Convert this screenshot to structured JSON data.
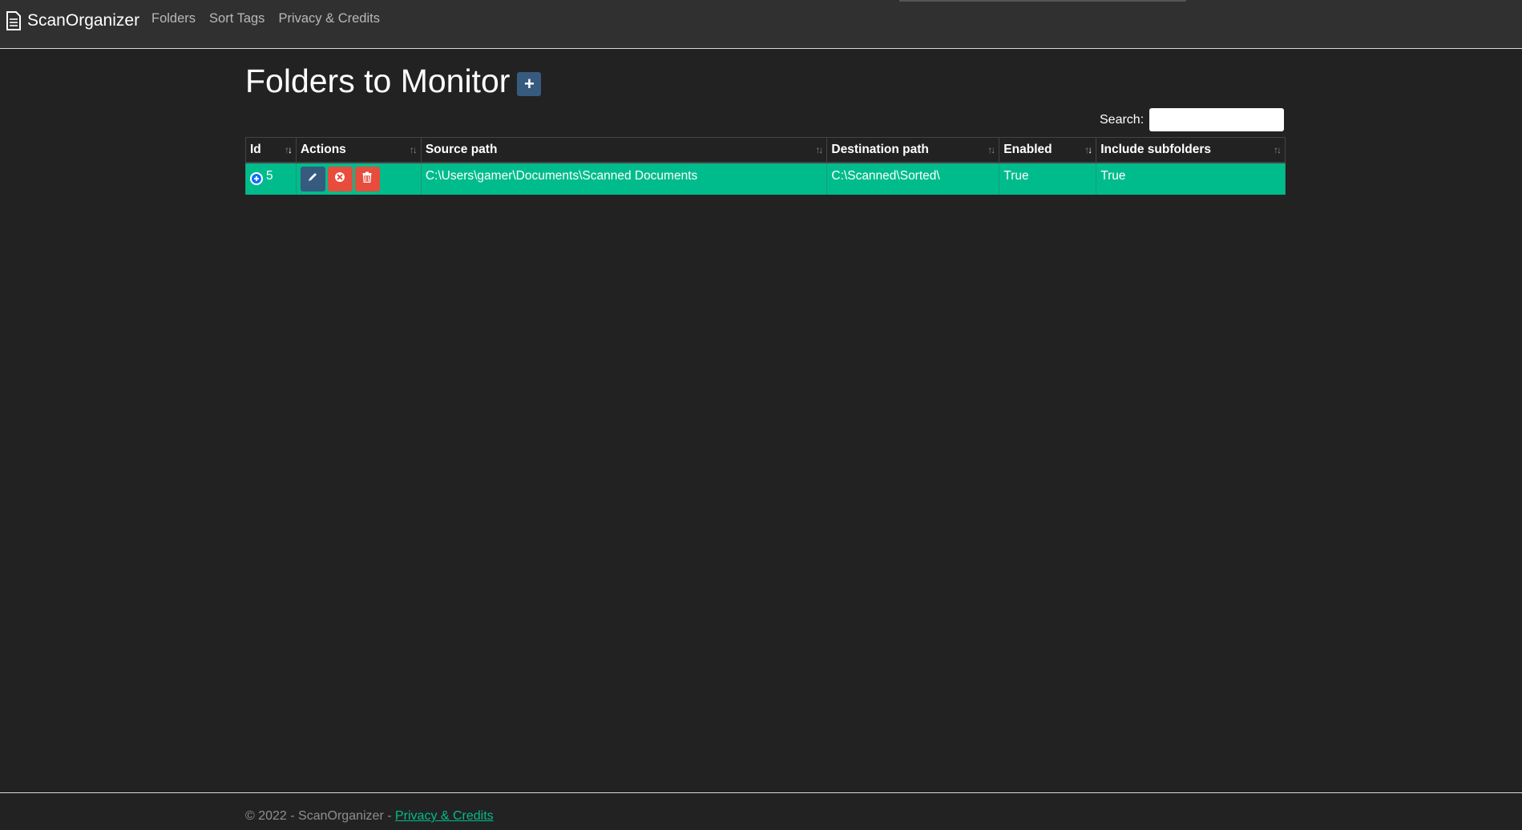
{
  "navbar": {
    "brand": "ScanOrganizer",
    "links": [
      "Folders",
      "Sort Tags",
      "Privacy & Credits"
    ]
  },
  "main": {
    "title": "Folders to Monitor",
    "add_label": "+",
    "search_label": "Search:",
    "search_value": "",
    "columns": [
      "Id",
      "Actions",
      "Source path",
      "Destination path",
      "Enabled",
      "Include subfolders"
    ],
    "rows": [
      {
        "id": "5",
        "source_path": "C:\\Users\\gamer\\Documents\\Scanned Documents",
        "destination_path": "C:\\Scanned\\Sorted\\",
        "enabled": "True",
        "include_subfolders": "True"
      }
    ]
  },
  "footer": {
    "text": "© 2022 - ScanOrganizer - ",
    "link": "Privacy & Credits"
  },
  "colors": {
    "background": "#222222",
    "navbar": "#303030",
    "row_highlight": "#00bc8c",
    "primary_button": "#375a7f",
    "danger_button": "#e74c3c"
  },
  "icons": [
    "document-icon",
    "plus-icon",
    "sort-icon",
    "expand-icon",
    "pencil-icon",
    "close-circle-icon",
    "trash-icon"
  ]
}
